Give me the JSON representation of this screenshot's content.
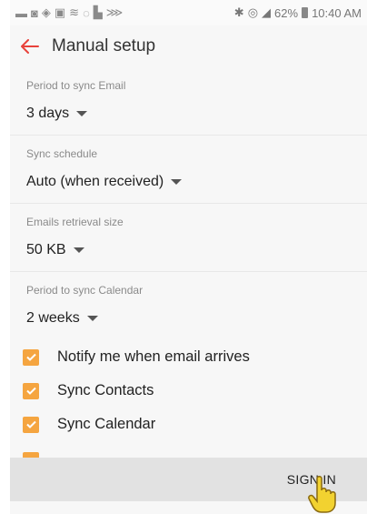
{
  "status_bar": {
    "battery": "62%",
    "time": "10:40 AM"
  },
  "header": {
    "title": "Manual setup"
  },
  "settings": [
    {
      "label": "Period to sync Email",
      "value": "3 days"
    },
    {
      "label": "Sync schedule",
      "value": "Auto (when received)"
    },
    {
      "label": "Emails retrieval size",
      "value": "50 KB"
    },
    {
      "label": "Period to sync Calendar",
      "value": "2 weeks"
    }
  ],
  "checkboxes": [
    {
      "label": "Notify me when email arrives",
      "checked": true
    },
    {
      "label": "Sync Contacts",
      "checked": true
    },
    {
      "label": "Sync Calendar",
      "checked": true
    }
  ],
  "footer": {
    "signin_label": "SIGN IN"
  },
  "colors": {
    "accent": "#e8423b",
    "checkbox": "#f5a540",
    "bottom_bar": "#e2e2e2"
  }
}
